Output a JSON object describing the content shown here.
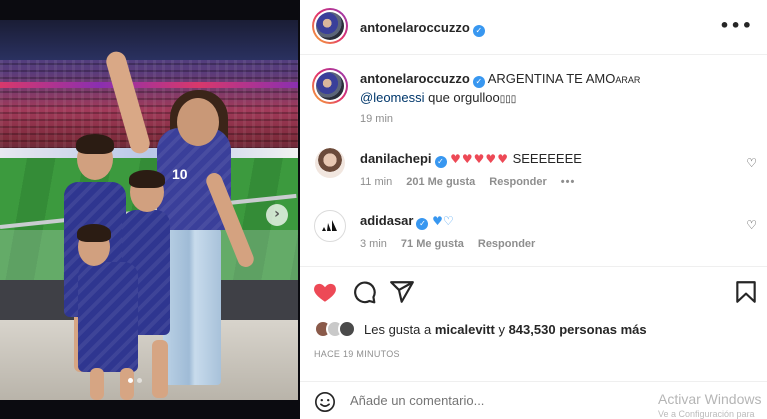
{
  "post": {
    "author": "antonelaroccuzzo",
    "caption": {
      "text": "ARGENTINA TE AMO",
      "suffix": "ARAR",
      "mention": "@leomessi",
      "text2": "que orgulloo",
      "trailing_glyphs": "▯▯▯"
    },
    "caption_time": "19 min"
  },
  "photo": {
    "shirt_number": "10"
  },
  "comments": [
    {
      "username": "danilachepi",
      "hearts": "♥♥♥♥♥",
      "text": "SEEEEEEE",
      "time": "11 min",
      "likes": "201 Me gusta",
      "reply": "Responder",
      "more": "•••"
    },
    {
      "username": "adidasar",
      "hearts": "♥♡",
      "time": "3 min",
      "likes": "71 Me gusta",
      "reply": "Responder"
    }
  ],
  "likes": {
    "prefix": "Les gusta a",
    "first_user": "micalevitt",
    "conjunction": "y",
    "count": "843,530",
    "suffix": "personas más"
  },
  "timestamp": "HACE 19 MINUTOS",
  "add_comment": {
    "placeholder": "Añade un comentario..."
  },
  "watermark": {
    "line1": "Activar Windows",
    "line2": "Ve a Configuración para"
  },
  "colors": {
    "like_red": "#ed4956",
    "verified_blue": "#3897f0",
    "mention_blue": "#00376b",
    "muted_gray": "#8e8e8e"
  },
  "icons": [
    "verified-badge-icon",
    "more-options-icon",
    "heart-icon",
    "comment-icon",
    "share-icon",
    "bookmark-icon",
    "emoji-icon",
    "adidas-logo-icon"
  ]
}
